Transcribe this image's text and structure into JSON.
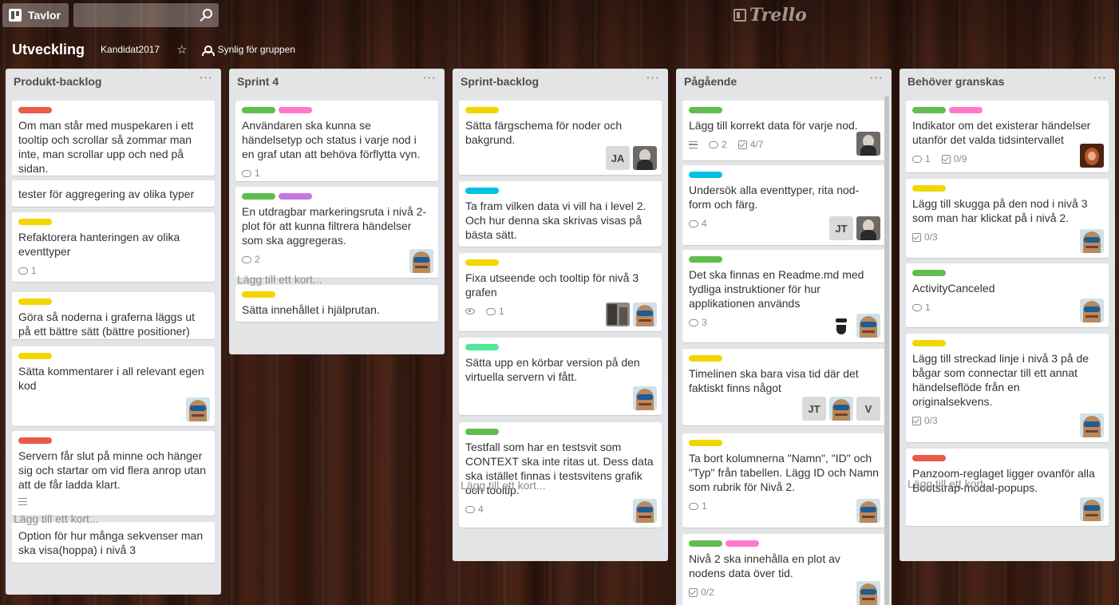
{
  "header": {
    "boards_label": "Tavlor",
    "logo_text": "Trello"
  },
  "board": {
    "title": "Utveckling",
    "team": "Kandidat2017",
    "visibility": "Synlig för gruppen"
  },
  "colors": {
    "red": "#eb5a46",
    "green": "#61bd4f",
    "pink": "#ff78cb",
    "yellow": "#f2d600",
    "purple": "#c377e0",
    "sky": "#00c2e0",
    "lime": "#51e898"
  },
  "lists": [
    {
      "title": "Produkt-backlog",
      "add_card": "Lägg till ett kort...",
      "cards": [
        {
          "labels": [
            "red"
          ],
          "title": "Om man står med muspekaren i ett tooltip och scrollar så zommar man inte, man scrollar upp och ned på sidan."
        },
        {
          "labels": [],
          "title": "tester för aggregering av olika typer"
        },
        {
          "labels": [
            "yellow"
          ],
          "title": "Refaktorera hanteringen av olika eventtyper",
          "comments": "1"
        },
        {
          "labels": [
            "yellow"
          ],
          "title": "Göra så noderna i graferna läggs ut på ett bättre sätt (bättre positioner)"
        },
        {
          "labels": [
            "yellow"
          ],
          "title": "Sätta kommentarer i all relevant egen kod",
          "members": [
            "goggles"
          ]
        },
        {
          "labels": [
            "red"
          ],
          "title": "Servern får slut på minne och hänger sig och startar om vid flera anrop utan att de får ladda klart.",
          "description": true
        },
        {
          "labels": [],
          "title": "Option för hur många sekvenser man ska visa(hoppa) i nivå 3"
        }
      ]
    },
    {
      "title": "Sprint 4",
      "add_card": "Lägg till ett kort...",
      "cards": [
        {
          "labels": [
            "green",
            "pink"
          ],
          "title": "Användaren ska kunna se händelsetyp och status i varje nod i en graf utan att behöva förflytta vyn.",
          "comments": "1"
        },
        {
          "labels": [
            "green",
            "purple"
          ],
          "title": "En utdragbar markeringsruta i nivå 2-plot för att kunna filtrera händelser som ska aggregeras.",
          "comments": "2",
          "members": [
            "goggles"
          ]
        },
        {
          "labels": [
            "yellow"
          ],
          "title": "Sätta innehållet i hjälprutan."
        }
      ]
    },
    {
      "title": "Sprint-backlog",
      "add_card": "Lägg till ett kort...",
      "cards": [
        {
          "labels": [
            "yellow"
          ],
          "title": "Sätta färgschema för noder och bakgrund.",
          "members": [
            "JA",
            "dark"
          ]
        },
        {
          "labels": [
            "sky"
          ],
          "title": "Ta fram vilken data vi vill ha i level 2. Och hur denna ska skrivas visas på bästa sätt."
        },
        {
          "labels": [
            "yellow"
          ],
          "title": "Fixa utseende och tooltip för nivå 3 grafen",
          "watch": true,
          "comments": "1",
          "members": [
            "photo",
            "goggles"
          ]
        },
        {
          "labels": [
            "lime"
          ],
          "title": "Sätta upp en körbar version på den virtuella servern vi fått.",
          "members": [
            "goggles"
          ]
        },
        {
          "labels": [
            "green"
          ],
          "title": "Testfall som har en testsvit som CONTEXT ska inte ritas ut. Dess data ska istället finnas i testsvitens grafik och tooltip.",
          "comments": "4",
          "members": [
            "goggles"
          ]
        }
      ]
    },
    {
      "title": "Pågående",
      "add_card": "",
      "cards": [
        {
          "labels": [
            "green"
          ],
          "title": "Lägg till korrekt data för varje nod.",
          "description": true,
          "comments": "2",
          "checklist": "4/7",
          "members": [
            "dark"
          ]
        },
        {
          "labels": [
            "sky"
          ],
          "title": "Undersök alla eventtyper, rita nod-form och färg.",
          "comments": "4",
          "members": [
            "JT",
            "dark"
          ]
        },
        {
          "labels": [
            "green"
          ],
          "title": "Det ska finnas en Readme.md med tydliga instruktioner för hur applikationen används",
          "comments": "3",
          "members": [
            "beard",
            "goggles"
          ]
        },
        {
          "labels": [
            "yellow"
          ],
          "title": "Timelinen ska bara visa tid där det faktiskt finns något",
          "members": [
            "JT",
            "goggles",
            "V"
          ]
        },
        {
          "labels": [
            "yellow"
          ],
          "title": "Ta bort kolumnerna \"Namn\", \"ID\" och \"Typ\" från tabellen. Lägg ID och Namn som rubrik för Nivå 2.",
          "comments": "1",
          "members": [
            "goggles"
          ]
        },
        {
          "labels": [
            "green",
            "pink"
          ],
          "title": "Nivå 2 ska innehålla en plot av nodens data över tid.",
          "checklist": "0/2",
          "members": [
            "goggles"
          ]
        }
      ]
    },
    {
      "title": "Behöver granskas",
      "add_card": "Lägg till ett kort...",
      "cards": [
        {
          "labels": [
            "green",
            "pink"
          ],
          "title": "Indikator om det existerar händelser utanför det valda tidsintervallet",
          "comments": "1",
          "checklist": "0/9",
          "members": [
            "red"
          ]
        },
        {
          "labels": [
            "yellow"
          ],
          "title": "Lägg till skugga på den nod i nivå 3 som man har klickat på i nivå 2.",
          "checklist": "0/3",
          "members": [
            "goggles"
          ]
        },
        {
          "labels": [
            "green"
          ],
          "title": "ActivityCanceled",
          "comments": "1",
          "members": [
            "goggles"
          ]
        },
        {
          "labels": [
            "yellow"
          ],
          "title": "Lägg till streckad linje i nivå 3 på de bågar som connectar till ett annat händelseflöde från en originalsekvens.",
          "checklist": "0/3",
          "members": [
            "goggles"
          ]
        },
        {
          "labels": [
            "red"
          ],
          "title": "Panzoom-reglaget ligger ovanför alla Bootstrap-modal-popups.",
          "members": [
            "goggles"
          ]
        }
      ]
    }
  ]
}
